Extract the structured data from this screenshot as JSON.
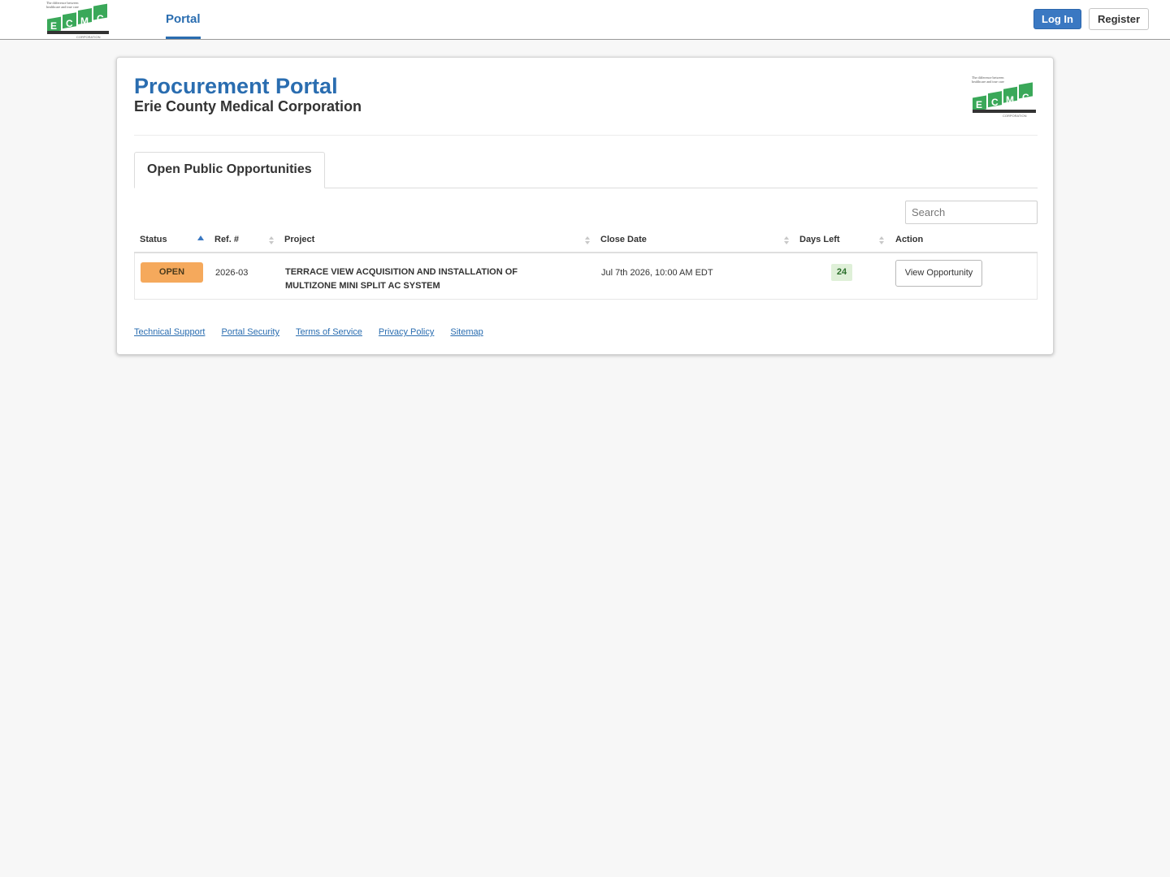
{
  "nav": {
    "logo_tagline": "The difference between healthcare and true care",
    "logo_letters": [
      "E",
      "C",
      "M",
      "C"
    ],
    "logo_sub": "CORPORATION",
    "portal_link": "Portal",
    "login_label": "Log In",
    "register_label": "Register"
  },
  "header": {
    "title": "Procurement Portal",
    "subtitle": "Erie County Medical Corporation"
  },
  "tabs": [
    {
      "label": "Open Public Opportunities",
      "active": true
    }
  ],
  "search": {
    "placeholder": "Search"
  },
  "table": {
    "columns": [
      "Status",
      "Ref. #",
      "Project",
      "Close Date",
      "Days Left",
      "Action"
    ],
    "rows": [
      {
        "status": "OPEN",
        "ref": "2026-03",
        "project": "TERRACE VIEW ACQUISITION AND INSTALLATION OF MULTIZONE MINI SPLIT AC SYSTEM",
        "close_date": "Jul 7th 2026, 10:00 AM EDT",
        "days_left": "24",
        "action": "View Opportunity"
      }
    ]
  },
  "footer": {
    "links": [
      "Technical Support",
      "Portal Security",
      "Terms of Service",
      "Privacy Policy",
      "Sitemap"
    ]
  },
  "colors": {
    "brand_blue": "#2a6db0",
    "login_blue": "#3a78c2",
    "status_open": "#f5a95c",
    "days_badge_bg": "#dff0d8",
    "logo_green": "#3aa859"
  }
}
